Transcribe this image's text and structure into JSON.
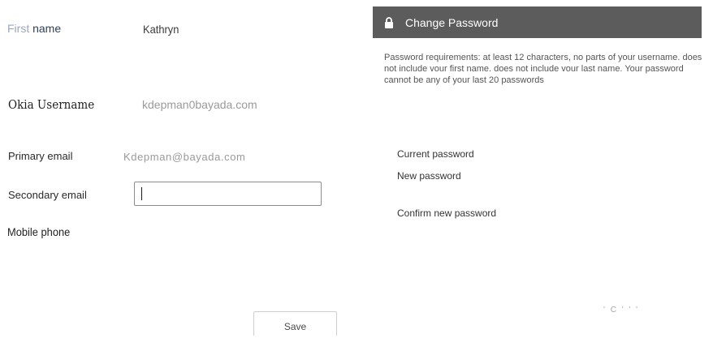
{
  "profile": {
    "first_name": {
      "label_part1": "First",
      "label_part2": " name",
      "value": "Kathryn"
    },
    "okta_username": {
      "label": "Okia Username",
      "value": "kdepman0bayada.com"
    },
    "primary_email": {
      "label": "Primary email",
      "value": "Kdepman@bayada.com"
    },
    "secondary_email": {
      "label": "Secondary email",
      "value": ""
    },
    "mobile_phone": {
      "label": "Mobile phone"
    },
    "save_label": "Save"
  },
  "change_password": {
    "title": "Change Password",
    "icon": "lock-icon",
    "requirements": "Password requirements: at least 12 characters, no parts of your username. does not include vour first name. does not include vour last name. Your password cannot be any of your last 20 passwords",
    "current_label": "Current password",
    "new_label": "New password",
    "confirm_label": "Confirm new password"
  },
  "footer": {
    "faint_marks": "' C '     ' '"
  },
  "colors": {
    "panel_header": "#5c5c5c",
    "label_muted": "#9aa7bd",
    "label_dark": "#2d3e66",
    "value_gray": "#9a9a9a"
  }
}
